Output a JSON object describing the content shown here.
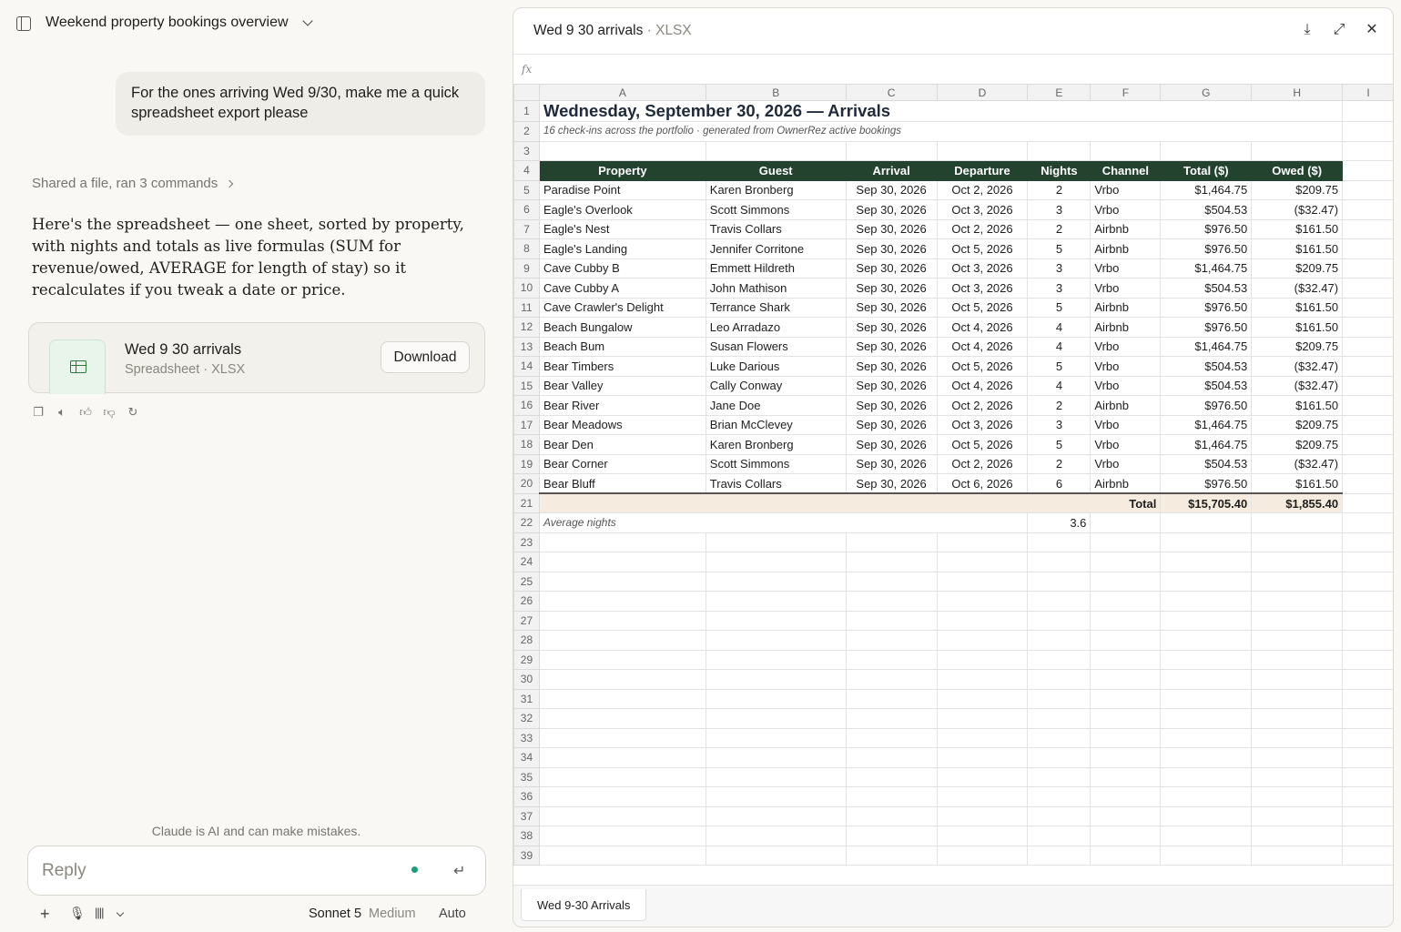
{
  "chat": {
    "title": "Weekend property bookings overview",
    "user_message": "For the ones arriving Wed 9/30, make me a quick spreadsheet export please",
    "activity": "Shared a file, ran 3 commands",
    "assistant_message": "Here's the spreadsheet — one sheet, sorted by property, with nights and totals as live formulas (SUM for revenue/owed, AVERAGE for length of stay) so it recalculates if you tweak a date or price.",
    "file": {
      "name": "Wed 9 30 arrivals",
      "meta": "Spreadsheet · XLSX",
      "download_label": "Download"
    },
    "disclaimer": "Claude is AI and can make mistakes.",
    "reply_placeholder": "Reply",
    "model": {
      "name": "Sonnet 5",
      "effort": "Medium",
      "mode": "Auto"
    }
  },
  "preview": {
    "title": "Wed 9 30 arrivals",
    "type": " · XLSX",
    "formula_label": "fx",
    "columns": [
      "A",
      "B",
      "C",
      "D",
      "E",
      "F",
      "G",
      "H",
      "I"
    ],
    "sheet_title": "Wednesday, September 30, 2026 — Arrivals",
    "sheet_subtitle": "16 check-ins across the portfolio · generated from OwnerRez active bookings",
    "headers": [
      "Property",
      "Guest",
      "Arrival",
      "Departure",
      "Nights",
      "Channel",
      "Total ($)",
      "Owed ($)"
    ],
    "rows": [
      [
        "Paradise Point",
        "Karen Bronberg",
        "Sep 30, 2026",
        "Oct 2, 2026",
        "2",
        "Vrbo",
        "$1,464.75",
        "$209.75"
      ],
      [
        "Eagle's Overlook",
        "Scott Simmons",
        "Sep 30, 2026",
        "Oct 3, 2026",
        "3",
        "Vrbo",
        "$504.53",
        "($32.47)"
      ],
      [
        "Eagle's Nest",
        "Travis Collars",
        "Sep 30, 2026",
        "Oct 2, 2026",
        "2",
        "Airbnb",
        "$976.50",
        "$161.50"
      ],
      [
        "Eagle's Landing",
        "Jennifer Corritone",
        "Sep 30, 2026",
        "Oct 5, 2026",
        "5",
        "Airbnb",
        "$976.50",
        "$161.50"
      ],
      [
        "Cave Cubby B",
        "Emmett Hildreth",
        "Sep 30, 2026",
        "Oct 3, 2026",
        "3",
        "Vrbo",
        "$1,464.75",
        "$209.75"
      ],
      [
        "Cave Cubby A",
        "John Mathison",
        "Sep 30, 2026",
        "Oct 3, 2026",
        "3",
        "Vrbo",
        "$504.53",
        "($32.47)"
      ],
      [
        "Cave Crawler's Delight",
        "Terrance Shark",
        "Sep 30, 2026",
        "Oct 5, 2026",
        "5",
        "Airbnb",
        "$976.50",
        "$161.50"
      ],
      [
        "Beach Bungalow",
        "Leo Arradazo",
        "Sep 30, 2026",
        "Oct 4, 2026",
        "4",
        "Airbnb",
        "$976.50",
        "$161.50"
      ],
      [
        "Beach Bum",
        "Susan Flowers",
        "Sep 30, 2026",
        "Oct 4, 2026",
        "4",
        "Vrbo",
        "$1,464.75",
        "$209.75"
      ],
      [
        "Bear Timbers",
        "Luke Darious",
        "Sep 30, 2026",
        "Oct 5, 2026",
        "5",
        "Vrbo",
        "$504.53",
        "($32.47)"
      ],
      [
        "Bear Valley",
        "Cally Conway",
        "Sep 30, 2026",
        "Oct 4, 2026",
        "4",
        "Vrbo",
        "$504.53",
        "($32.47)"
      ],
      [
        "Bear River",
        "Jane Doe",
        "Sep 30, 2026",
        "Oct 2, 2026",
        "2",
        "Airbnb",
        "$976.50",
        "$161.50"
      ],
      [
        "Bear Meadows",
        "Brian McClevey",
        "Sep 30, 2026",
        "Oct 3, 2026",
        "3",
        "Vrbo",
        "$1,464.75",
        "$209.75"
      ],
      [
        "Bear Den",
        "Karen Bronberg",
        "Sep 30, 2026",
        "Oct 5, 2026",
        "5",
        "Vrbo",
        "$1,464.75",
        "$209.75"
      ],
      [
        "Bear Corner",
        "Scott Simmons",
        "Sep 30, 2026",
        "Oct 2, 2026",
        "2",
        "Vrbo",
        "$504.53",
        "($32.47)"
      ],
      [
        "Bear Bluff",
        "Travis Collars",
        "Sep 30, 2026",
        "Oct 6, 2026",
        "6",
        "Airbnb",
        "$976.50",
        "$161.50"
      ]
    ],
    "total_label": "Total",
    "total_revenue": "$15,705.40",
    "total_owed": "$1,855.40",
    "avg_label": "Average nights",
    "avg_value": "3.6",
    "row_count": 39,
    "sheet_tab": "Wed 9-30 Arrivals"
  }
}
